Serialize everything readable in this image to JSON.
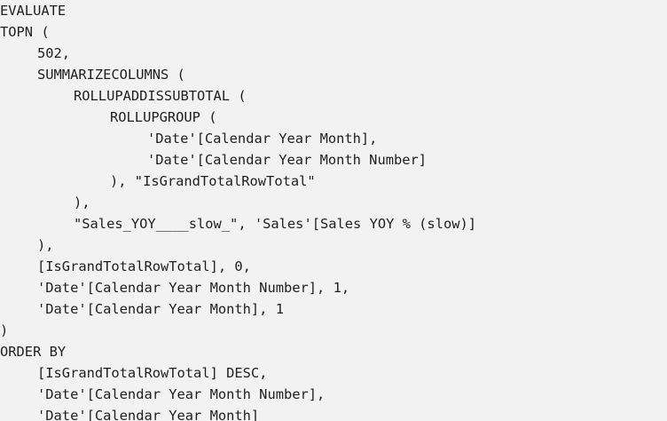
{
  "editor": {
    "lines": [
      {
        "text": "EVALUATE"
      },
      {
        "text": "TOPN ("
      },
      {
        "text": "502,"
      },
      {
        "text": "SUMMARIZECOLUMNS ("
      },
      {
        "text": "ROLLUPADDISSUBTOTAL ("
      },
      {
        "text": "ROLLUPGROUP ("
      },
      {
        "text": "'Date'[Calendar Year Month],"
      },
      {
        "text": "'Date'[Calendar Year Month Number]"
      },
      {
        "text": "), \"IsGrandTotalRowTotal\""
      },
      {
        "text": "),"
      },
      {
        "text": "\"Sales_YOY____slow_\", 'Sales'[Sales YOY % (slow)]"
      },
      {
        "text": "),"
      },
      {
        "text": "[IsGrandTotalRowTotal], 0,"
      },
      {
        "text": "'Date'[Calendar Year Month Number], 1,"
      },
      {
        "text": "'Date'[Calendar Year Month], 1"
      },
      {
        "text": ")"
      },
      {
        "text": "ORDER BY"
      },
      {
        "text": "[IsGrandTotalRowTotal] DESC,"
      },
      {
        "text": "'Date'[Calendar Year Month Number],"
      },
      {
        "text": "'Date'[Calendar Year Month]"
      }
    ]
  }
}
